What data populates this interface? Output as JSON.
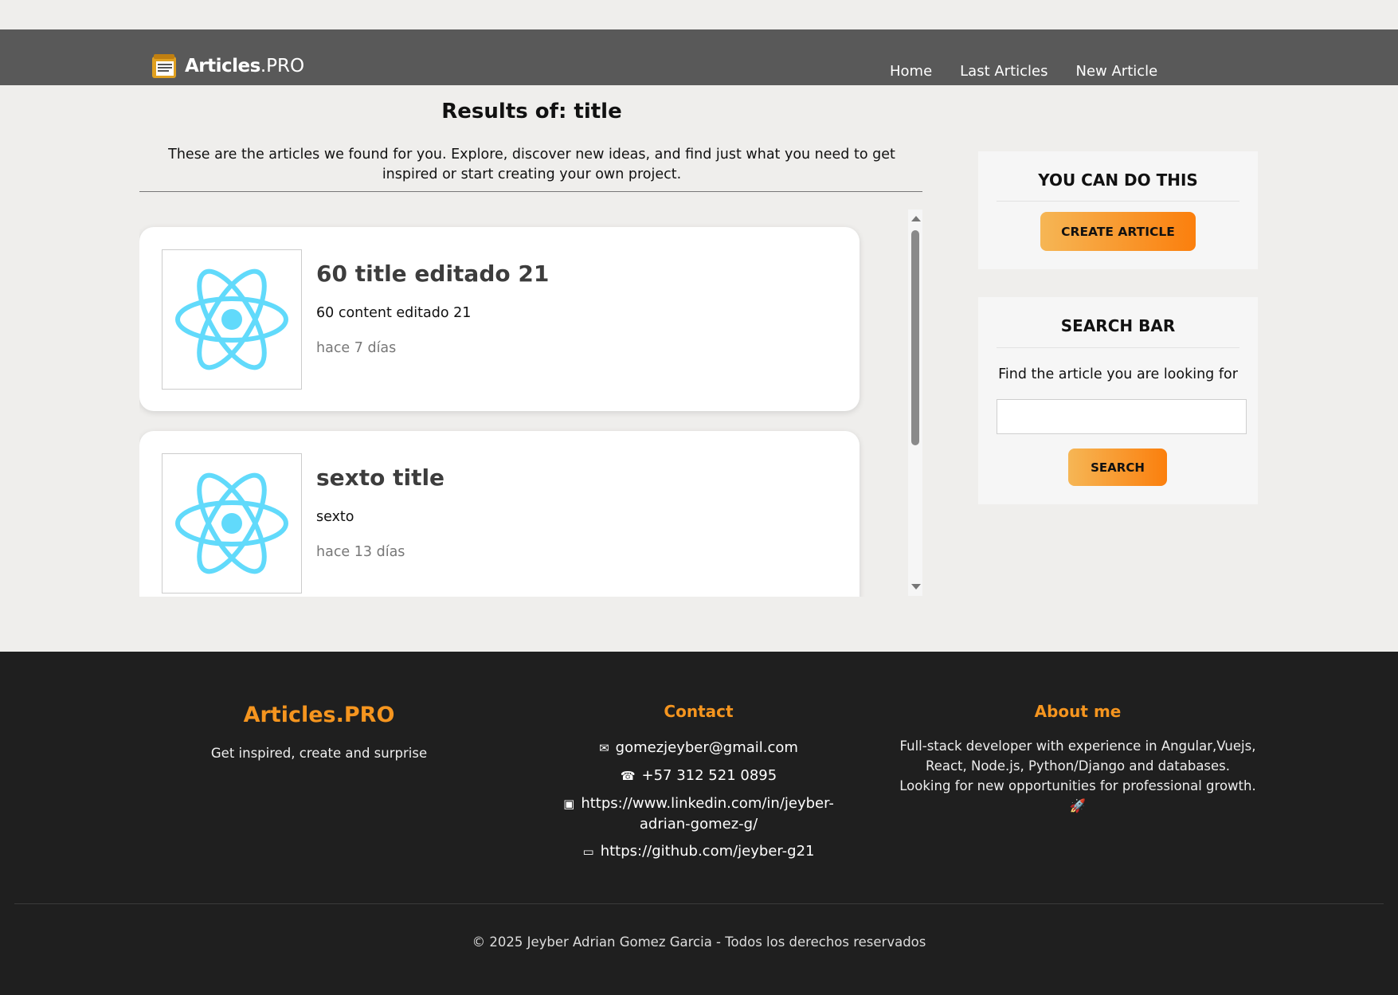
{
  "header": {
    "brand_bold": "Articles",
    "brand_rest": ".PRO",
    "nav": [
      "Home",
      "Last Articles",
      "New Article"
    ]
  },
  "main": {
    "title": "Results of: title",
    "intro": "These are the articles we found for you. Explore, discover new ideas, and find just what you need to get inspired or start creating your own project.",
    "articles": [
      {
        "title": "60 title editado 21",
        "content": "60 content editado 21",
        "date": "hace 7 días",
        "image": "react-logo"
      },
      {
        "title": "sexto title",
        "content": "sexto",
        "date": "hace 13 días",
        "image": "react-logo"
      }
    ]
  },
  "sidebar": {
    "create_widget": {
      "heading": "YOU CAN DO THIS",
      "button": "CREATE ARTICLE"
    },
    "search_widget": {
      "heading": "SEARCH BAR",
      "text": "Find the article you are looking for",
      "input_value": "",
      "button": "SEARCH"
    }
  },
  "footer": {
    "brand": "Articles.PRO",
    "tagline": "Get inspired, create and surprise",
    "contact_heading": "Contact",
    "contact": [
      {
        "icon": "envelope-icon",
        "text": "gomezjeyber@gmail.com"
      },
      {
        "icon": "phone-icon",
        "text": "+57 312 521 0895"
      },
      {
        "icon": "briefcase-icon",
        "text": "https://www.linkedin.com/in/jeyber-adrian-gomez-g/"
      },
      {
        "icon": "laptop-icon",
        "text": "https://github.com/jeyber-g21"
      }
    ],
    "about_heading": "About me",
    "about": "Full-stack developer with experience in Angular,Vuejs, React, Node.js, Python/Django and databases. Looking for new opportunities for professional growth. 🚀",
    "copyright": "© 2025 Jeyber Adrian Gomez Garcia - Todos los derechos reservados"
  },
  "colors": {
    "navbar": "#595959",
    "accent": "#f5951f",
    "footer": "#1f1f1f",
    "react": "#61dafb"
  }
}
